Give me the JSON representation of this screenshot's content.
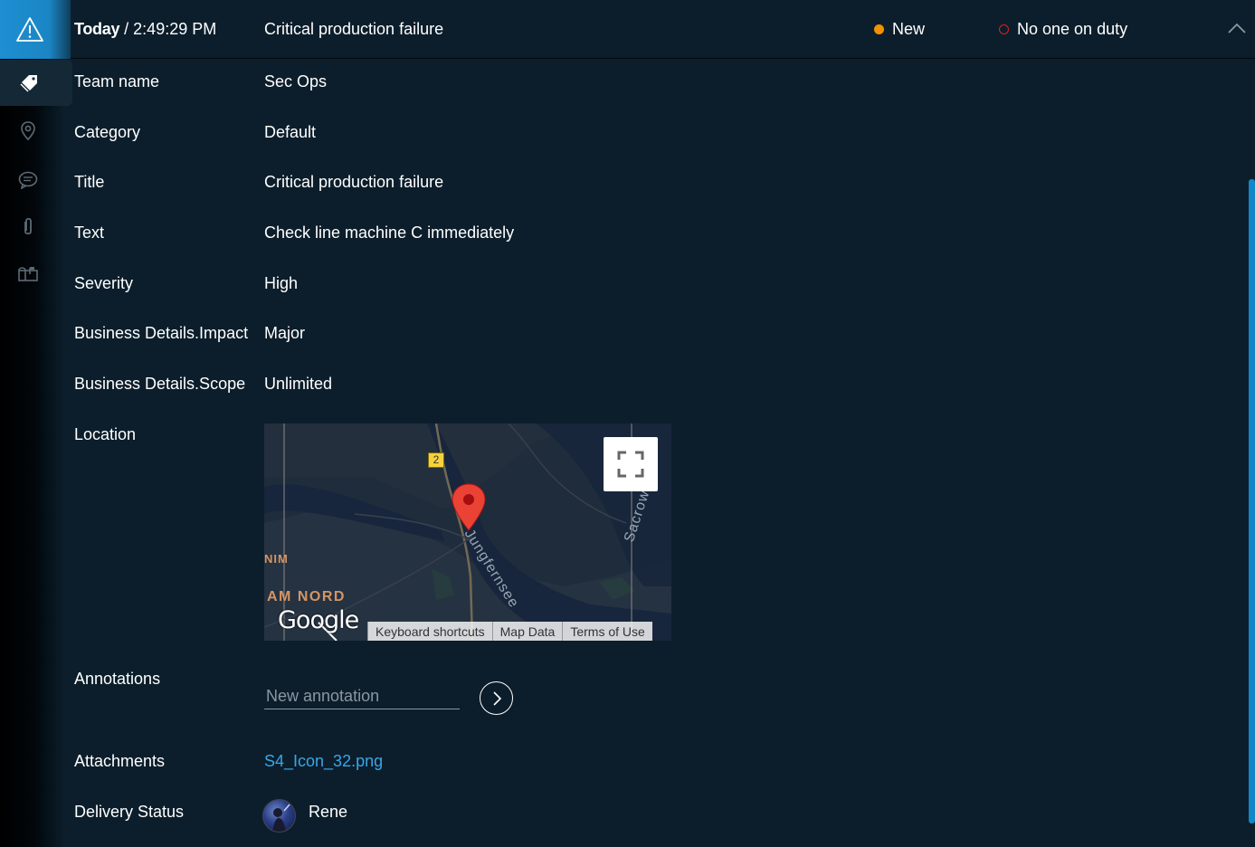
{
  "header": {
    "day": "Today",
    "time": " / 2:49:29 PM",
    "title": "Critical production failure",
    "status": "New",
    "duty": "No one on duty",
    "status_color": "#f39200",
    "duty_color": "#e02020"
  },
  "sidebar": {
    "items": [
      {
        "icon": "warning-triangle-icon"
      },
      {
        "icon": "tag-icon"
      },
      {
        "icon": "location-pin-icon"
      },
      {
        "icon": "chat-icon"
      },
      {
        "icon": "paperclip-icon"
      },
      {
        "icon": "mailbox-icon"
      }
    ]
  },
  "details": [
    {
      "label": "Team name",
      "value": "Sec Ops"
    },
    {
      "label": "Category",
      "value": "Default"
    },
    {
      "label": "Title",
      "value": "Critical production failure"
    },
    {
      "label": "Text",
      "value": "Check line machine C immediately"
    },
    {
      "label": "Severity",
      "value": "High"
    },
    {
      "label": "Business Details.Impact",
      "value": "Major"
    },
    {
      "label": "Business Details.Scope",
      "value": "Unlimited"
    }
  ],
  "location": {
    "label": "Location",
    "map": {
      "labels": {
        "nord": "AM NORD",
        "nim": "NIM",
        "jung": "Jungfernsee",
        "sacr": "Sacrow",
        "route": "2"
      },
      "logo": "Google",
      "footer": [
        "Keyboard shortcuts",
        "Map Data",
        "Terms of Use"
      ]
    }
  },
  "annotations": {
    "label": "Annotations",
    "placeholder": "New annotation"
  },
  "attachments": {
    "label": "Attachments",
    "file": "S4_Icon_32.png"
  },
  "delivery": {
    "label": "Delivery Status",
    "user": "Rene"
  }
}
